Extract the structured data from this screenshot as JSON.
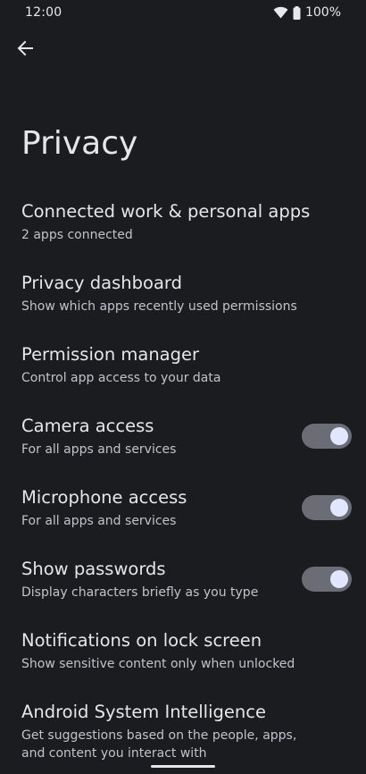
{
  "status_bar": {
    "time": "12:00",
    "battery": "100%",
    "icons": [
      "wifi-icon",
      "battery-icon"
    ]
  },
  "header": {
    "back_icon": "arrow-back-icon"
  },
  "page": {
    "title": "Privacy"
  },
  "items": [
    {
      "title": "Connected work & personal apps",
      "summary": "2 apps connected",
      "toggle": null
    },
    {
      "title": "Privacy dashboard",
      "summary": "Show which apps recently used permissions",
      "toggle": null
    },
    {
      "title": "Permission manager",
      "summary": "Control app access to your data",
      "toggle": null
    },
    {
      "title": "Camera access",
      "summary": "For all apps and services",
      "toggle": true
    },
    {
      "title": "Microphone access",
      "summary": "For all apps and services",
      "toggle": true
    },
    {
      "title": "Show passwords",
      "summary": "Display characters briefly as you type",
      "toggle": true
    },
    {
      "title": "Notifications on lock screen",
      "summary": "Show sensitive content only when unlocked",
      "toggle": null
    },
    {
      "title": "Android System Intelligence",
      "summary": "Get suggestions based on the people, apps, and content you interact with",
      "toggle": null
    }
  ],
  "colors": {
    "background": "#1b1c20",
    "text_primary": "#e6e5ec",
    "text_secondary": "#c3c2cb",
    "toggle_track_on": "#6a6d76",
    "toggle_thumb_on": "#e3e6ff"
  }
}
